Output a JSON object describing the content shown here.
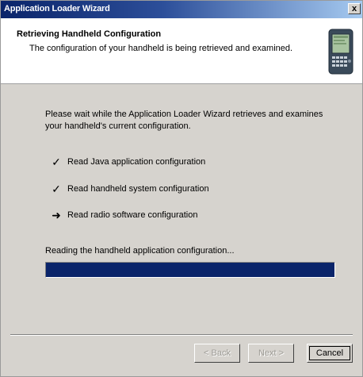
{
  "window": {
    "title": "Application Loader Wizard",
    "close_label": "x"
  },
  "header": {
    "title": "Retrieving Handheld Configuration",
    "subtitle": "The configuration of your handheld is being retrieved and examined."
  },
  "main": {
    "intro": "Please wait while the Application Loader Wizard retrieves and examines your handheld's current configuration.",
    "tasks": [
      {
        "icon": "checkmark-icon",
        "mark": "✓",
        "label": "Read Java application configuration"
      },
      {
        "icon": "checkmark-icon",
        "mark": "✓",
        "label": "Read handheld system configuration"
      },
      {
        "icon": "arrow-icon",
        "mark": "➜",
        "label": "Read radio software configuration"
      }
    ],
    "status": "Reading the handheld application configuration...",
    "progress_fraction": 1.0
  },
  "buttons": {
    "back": "< Back",
    "next": "Next >",
    "cancel": "Cancel"
  }
}
